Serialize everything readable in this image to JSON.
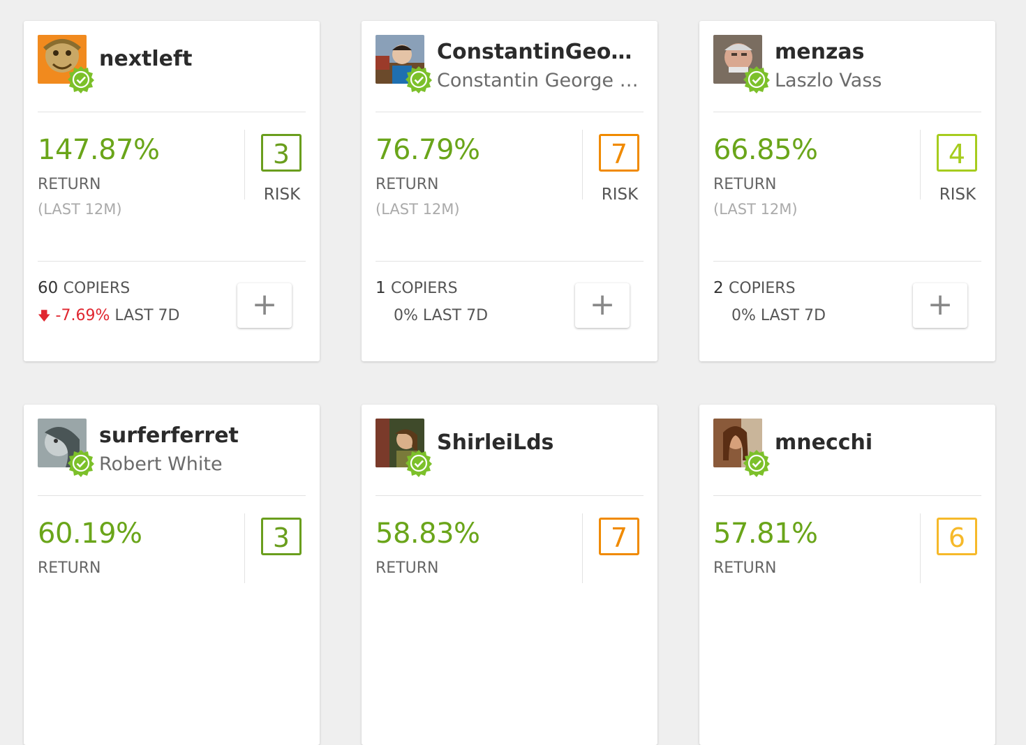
{
  "labels": {
    "return": "RETURN",
    "period": "(LAST 12M)",
    "risk": "RISK",
    "copiers": "COPIERS",
    "last7d": "LAST 7D",
    "add": "+"
  },
  "colors": {
    "return_green": "#6aa51a",
    "risk_green": "#6a9e1d",
    "risk_orange": "#f08a00",
    "risk_lime": "#a6cc1e",
    "risk_yellow": "#f6b92a",
    "negative": "#e0262f",
    "badge": "#7cc02a"
  },
  "cards": [
    {
      "username": "nextleft",
      "fullname": "",
      "return": "147.87%",
      "risk": "3",
      "risk_color": "#6a9e1d",
      "copiers": "60",
      "change": "-7.69%",
      "change_dir": "down",
      "avatar_icon": "avatar-mask"
    },
    {
      "username": "ConstantinGeorg...",
      "fullname": "Constantin George A...",
      "return": "76.79%",
      "risk": "7",
      "risk_color": "#f08a00",
      "copiers": "1",
      "change": "0%",
      "change_dir": "none",
      "avatar_icon": "avatar-photo"
    },
    {
      "username": "menzas",
      "fullname": "Laszlo Vass",
      "return": "66.85%",
      "risk": "4",
      "risk_color": "#a6cc1e",
      "copiers": "2",
      "change": "0%",
      "change_dir": "none",
      "avatar_icon": "avatar-photo"
    },
    {
      "username": "surferferret",
      "fullname": "Robert White",
      "return": "60.19%",
      "risk": "3",
      "risk_color": "#6a9e1d",
      "avatar_icon": "avatar-photo"
    },
    {
      "username": "ShirleiLds",
      "fullname": "",
      "return": "58.83%",
      "risk": "7",
      "risk_color": "#f08a00",
      "avatar_icon": "avatar-photo"
    },
    {
      "username": "mnecchi",
      "fullname": "",
      "return": "57.81%",
      "risk": "6",
      "risk_color": "#f6b92a",
      "avatar_icon": "avatar-photo"
    }
  ]
}
